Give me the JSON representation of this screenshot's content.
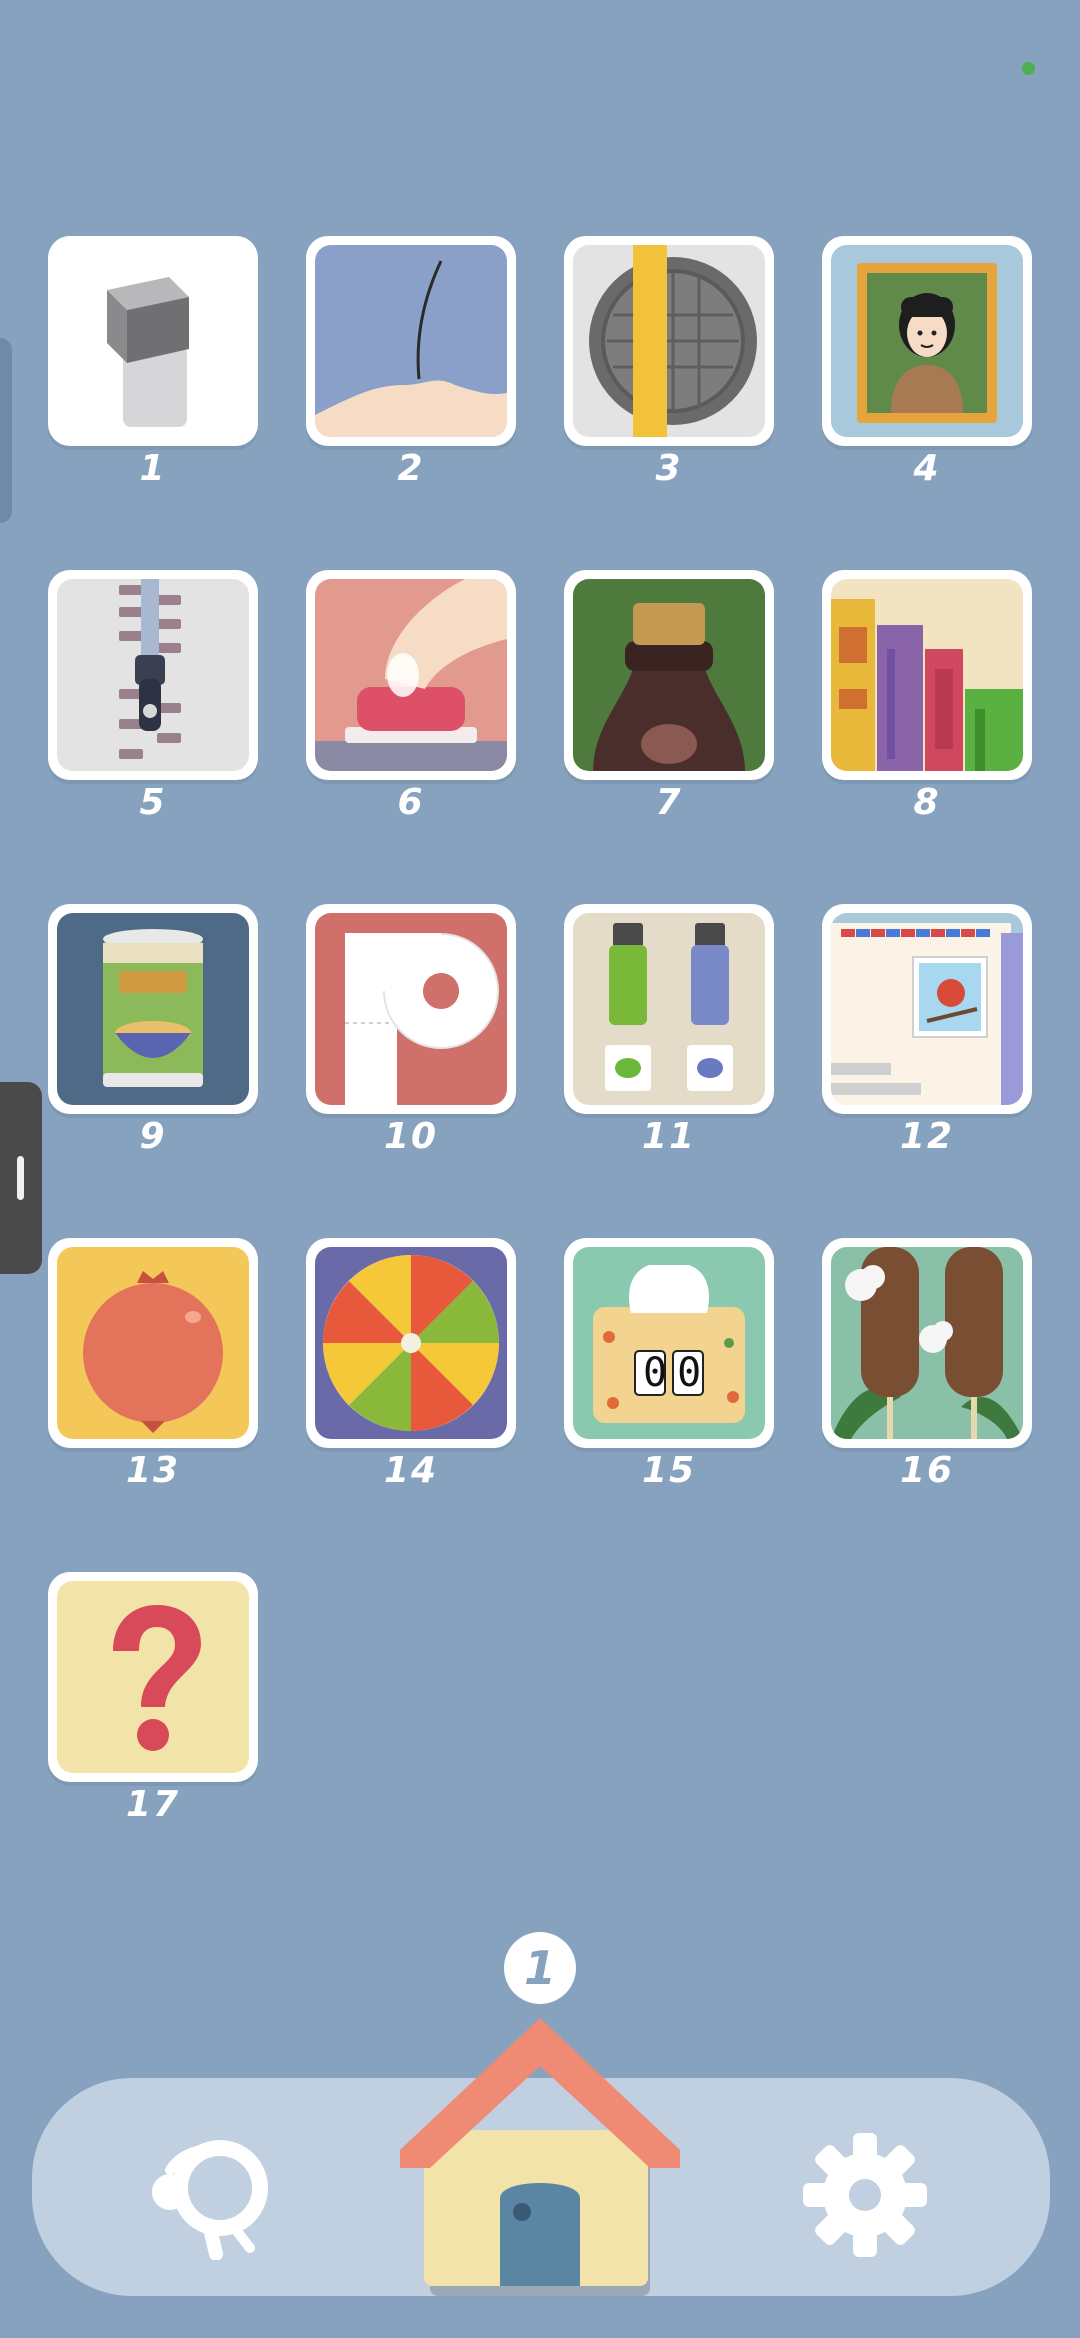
{
  "levels": [
    {
      "number": "1",
      "icon": "eraser-icon"
    },
    {
      "number": "2",
      "icon": "hair-strand-icon"
    },
    {
      "number": "3",
      "icon": "manhole-cover-icon"
    },
    {
      "number": "4",
      "icon": "portrait-painting-icon"
    },
    {
      "number": "5",
      "icon": "zipper-icon"
    },
    {
      "number": "6",
      "icon": "finger-button-icon"
    },
    {
      "number": "7",
      "icon": "bottle-cork-icon"
    },
    {
      "number": "8",
      "icon": "books-icon"
    },
    {
      "number": "9",
      "icon": "soup-can-icon"
    },
    {
      "number": "10",
      "icon": "toilet-paper-icon"
    },
    {
      "number": "11",
      "icon": "paint-tubes-icon"
    },
    {
      "number": "12",
      "icon": "envelope-stamp-icon"
    },
    {
      "number": "13",
      "icon": "pomegranate-icon"
    },
    {
      "number": "14",
      "icon": "lollipop-swirl-icon"
    },
    {
      "number": "15",
      "icon": "tissue-box-icon"
    },
    {
      "number": "16",
      "icon": "cattails-icon"
    },
    {
      "number": "17",
      "icon": "question-mark-icon"
    }
  ],
  "tile15_counter": "00",
  "bottom_nav": {
    "home_badge": "1",
    "hint_icon": "magnifier-hint-icon",
    "home_icon": "house-icon",
    "settings_icon": "gear-icon"
  },
  "colors": {
    "background": "#86a2be",
    "nav_bar": "#c0d0e0",
    "roof": "#ef8a75",
    "house_wall": "#f2e4a8",
    "door": "#5a86a4"
  }
}
